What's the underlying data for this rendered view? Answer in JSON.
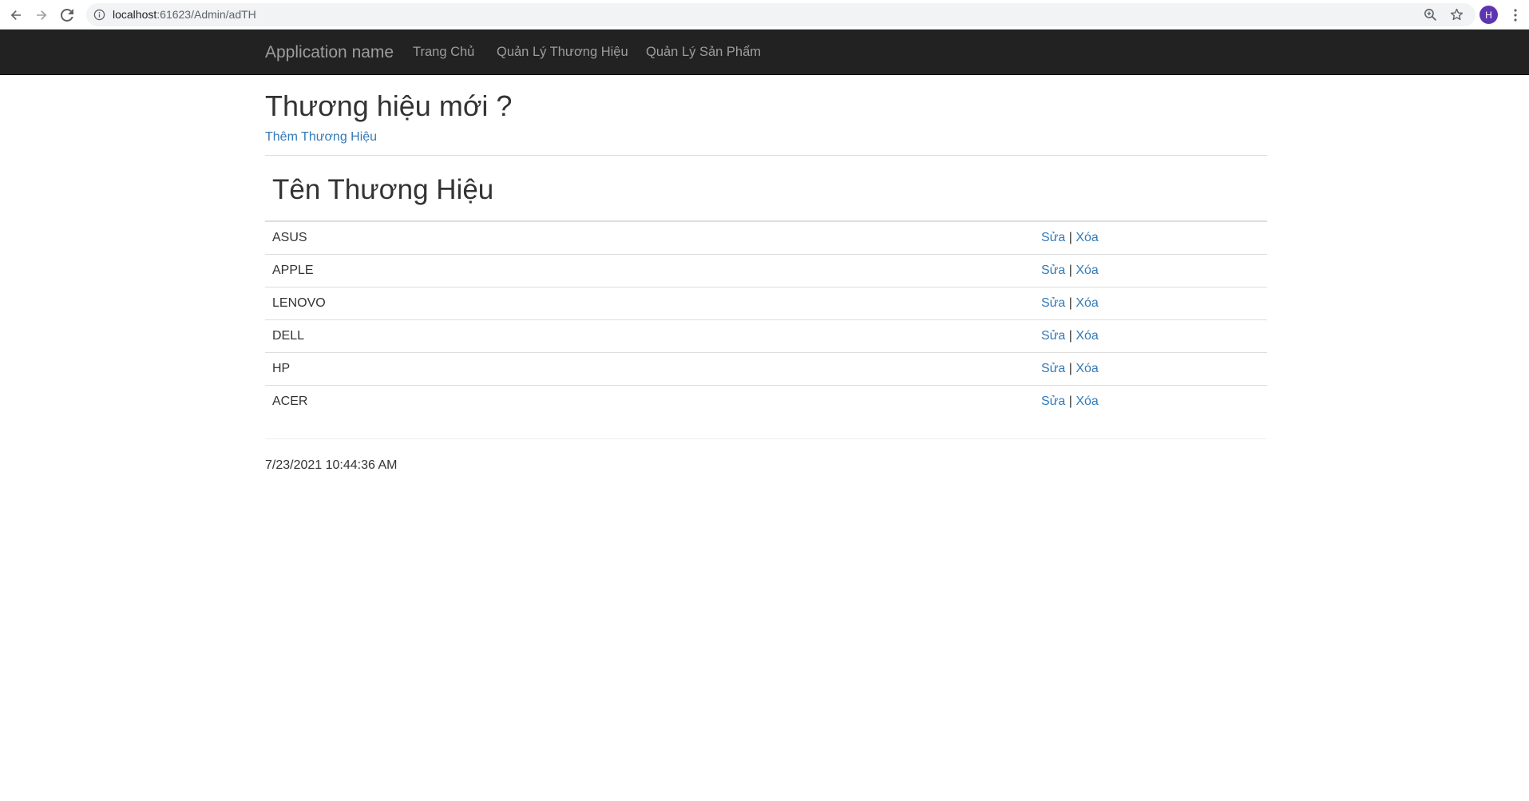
{
  "browser": {
    "url_host": "localhost",
    "url_path": ":61623/Admin/adTH",
    "profile_initial": "H",
    "icons": {
      "back": "arrow-left-icon",
      "forward": "arrow-right-icon",
      "reload": "reload-icon",
      "info": "info-icon",
      "zoom": "zoom-icon",
      "star": "star-icon",
      "menu": "menu-dots-icon"
    }
  },
  "navbar": {
    "brand": "Application name",
    "links": [
      {
        "label": "Trang Chủ"
      },
      {
        "label": "Quản Lý Thương Hiệu"
      },
      {
        "label": "Quản Lý Sản Phẩm"
      }
    ]
  },
  "main": {
    "title": "Thương hiệu mới ?",
    "add_link": "Thêm Thương Hiệu",
    "table": {
      "header": "Tên Thương Hiệu",
      "edit_label": "Sửa",
      "separator": "|",
      "delete_label": "Xóa",
      "rows": [
        {
          "name": "ASUS"
        },
        {
          "name": "APPLE"
        },
        {
          "name": "LENOVO"
        },
        {
          "name": "DELL"
        },
        {
          "name": "HP"
        },
        {
          "name": "ACER"
        }
      ]
    }
  },
  "footer": {
    "timestamp": "7/23/2021 10:44:36 AM"
  },
  "colors": {
    "navbar_bg": "#222222",
    "navbar_text": "#9d9d9d",
    "link": "#337ab7",
    "text": "#333333"
  }
}
